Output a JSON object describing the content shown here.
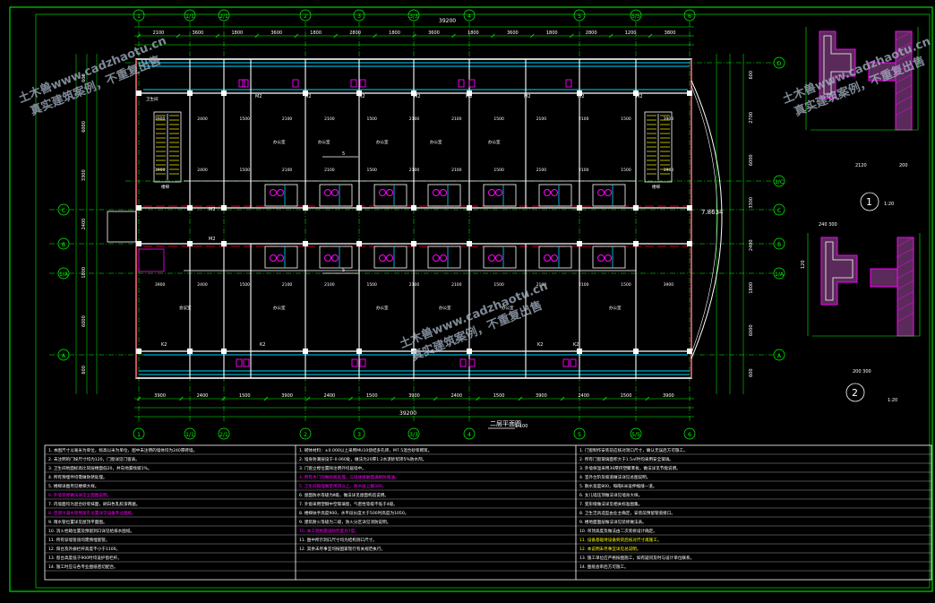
{
  "drawing": {
    "title": "二层平面图",
    "scale": "1:100",
    "total_width_dim": "39200",
    "level_mark": "7.8634",
    "section_label": "1-1",
    "section_marks": [
      "5",
      "5"
    ],
    "detail_callouts": [
      {
        "label": "1",
        "scale": "1:20"
      },
      {
        "label": "2",
        "scale": "1:20"
      }
    ],
    "detail_dims": {
      "d1_bottom": "2120",
      "d1_right": "200",
      "d2_bottom": "200 300",
      "d2_top": "240 300",
      "d2_left": "120"
    }
  },
  "axes": {
    "columns": [
      "1",
      "1/1",
      "2/1",
      "2",
      "3",
      "3/3",
      "4",
      "5",
      "5/5",
      "6"
    ],
    "columns_bottom": [
      "1",
      "1/1",
      "2/1",
      "2",
      "3",
      "3/3",
      "4",
      "5",
      "5/5",
      "6"
    ],
    "rows": [
      "A",
      "B",
      "C",
      "1/A"
    ],
    "rows_right": [
      "D",
      "1/C",
      "C",
      "B",
      "1/A",
      "A"
    ]
  },
  "dimensions": {
    "top_spans": [
      "2100",
      "3600",
      "1800",
      "3600",
      "1800",
      "2800",
      "1800",
      "3600",
      "1800",
      "3600",
      "1800",
      "2800",
      "1200",
      "3800"
    ],
    "bottom_spans": [
      "3900",
      "2400",
      "1500",
      "3900",
      "2400",
      "1500",
      "3900",
      "2400",
      "1500",
      "3900",
      "2400",
      "1500",
      "3900"
    ],
    "bottom_total": "39200",
    "left_spans": [
      "600",
      "6000",
      "3300",
      "2400",
      "1800",
      "6000",
      "600"
    ],
    "right_spans": [
      "600",
      "2700",
      "6000",
      "3300",
      "2400",
      "1800",
      "6000",
      "600"
    ],
    "room_mid": [
      "3900",
      "2400",
      "1500",
      "2100",
      "2100",
      "1500",
      "2100",
      "2100",
      "1500",
      "2100",
      "2100",
      "1500",
      "3900"
    ]
  },
  "rooms": [
    "卫生间",
    "办公室",
    "办公室",
    "办公室",
    "办公室",
    "办公室",
    "楼梯",
    "楼梯",
    "会议室",
    "办公室",
    "办公室",
    "办公室",
    "办公室",
    "办公室"
  ],
  "door_tags": [
    "M2",
    "M2",
    "M2",
    "M2",
    "M2",
    "M2",
    "M2",
    "M2",
    "M2",
    "M2",
    "K2",
    "K2",
    "K2",
    "K2"
  ],
  "notes": {
    "col1": [
      "1. 本图尺寸以毫米为单位，标高以米为单位，图中未注明的墙体均为240厚砖墙。",
      "2. 未注明的门垛尺寸均为120，门窗详见门窗表。",
      "3. 卫生间地面标高比同层楼面低20，并向地漏找坡1%。",
      "4. 所有预埋件均需做防锈处理。",
      "5. 楼梯详图另见楼梯大样。",
      "6. 外墙装修做法详见立面图说明。",
      "7. 内墙面均为混合砂浆抹面，刷白色乳胶漆两遍。",
      "8. 空调冷凝水管预留孔位置详见设备专业图纸。",
      "9. 雨水管位置详见屋顶平面图。",
      "10. 消火栓箱位置及预留洞口详见给排水图纸。",
      "11. 所有穿墙管道均需预埋套管。",
      "12. 阳台及外廊栏杆高度不小于1100。",
      "13. 窗台高度低于900时均设护窗栏杆。",
      "14. 施工时应与各专业图纸密切配合。"
    ],
    "col2": [
      "1. 砌体材料：±0.000以上采用MU10烧结多孔砖，M7.5混合砂浆砌筑。",
      "2. 墙身防潮层设于-0.060处，做法为20厚1:2水泥砂浆掺5%防水剂。",
      "3. 门窗立樘位置除注明外均居墙中。",
      "4. 所有木门均做防腐处理，与墙体接触面满刷防腐油。",
      "5. 卫生间隔墙做至吊顶以上，防水层上翻300。",
      "6. 屋面防水等级为Ⅱ级，做法详见屋面构造说明。",
      "7. 外窗采用塑钢中空玻璃窗，气密性等级不低于4级。",
      "8. 楼梯扶手高度900，水平段长度大于500时高度为1050。",
      "9. 建筑耐火等级为二级，防火分区详见消防说明。",
      "10. 本工程抗震设防烈度为7度。",
      "11. 图中所示洞口尺寸均为结构洞口尺寸。",
      "12. 其余未尽事宜均按国家现行有关规范执行。"
    ],
    "col3": [
      "1. 门窗制作安装前应核对洞口尺寸，确认无误后方可施工。",
      "2. 所有门窗玻璃面积大于1.5㎡时均采用安全玻璃。",
      "3. 外墙保温采用30厚挤塑聚苯板，做法详见节能说明。",
      "4. 室外台阶及坡道做法详见总图说明。",
      "5. 散水宽度800，每隔6米设伸缩缝一道。",
      "6. 女儿墙压顶做法详见墙身大样。",
      "7. 变形缝做法详见相关标准图集。",
      "8. 卫生洁具选型由业主确定，安装前预留管道接口。",
      "9. 楼地面面层做法详见装修做法表。",
      "10. 吊顶高度及做法由二次装修设计确定。",
      "11. 设备基础待设备到货后核对尺寸再施工。",
      "12. 本说明未尽事宜详见总说明。",
      "13. 施工单位应严格按图施工，如有疑问及时与设计单位联系。",
      "14. 图纸会审后方可施工。"
    ]
  },
  "watermark": {
    "line1": "土木兽www.cadzhaotu.cn",
    "line2": "真实建筑案例，不重复出售"
  },
  "colors": {
    "background": "#000000",
    "axis": "#00ff00",
    "wall": "#ffffff",
    "wall_red": "#ff0033",
    "window": "#00d8ff",
    "text": "#ffffff",
    "magenta": "#ff00ff",
    "yellow": "#ffff00"
  }
}
